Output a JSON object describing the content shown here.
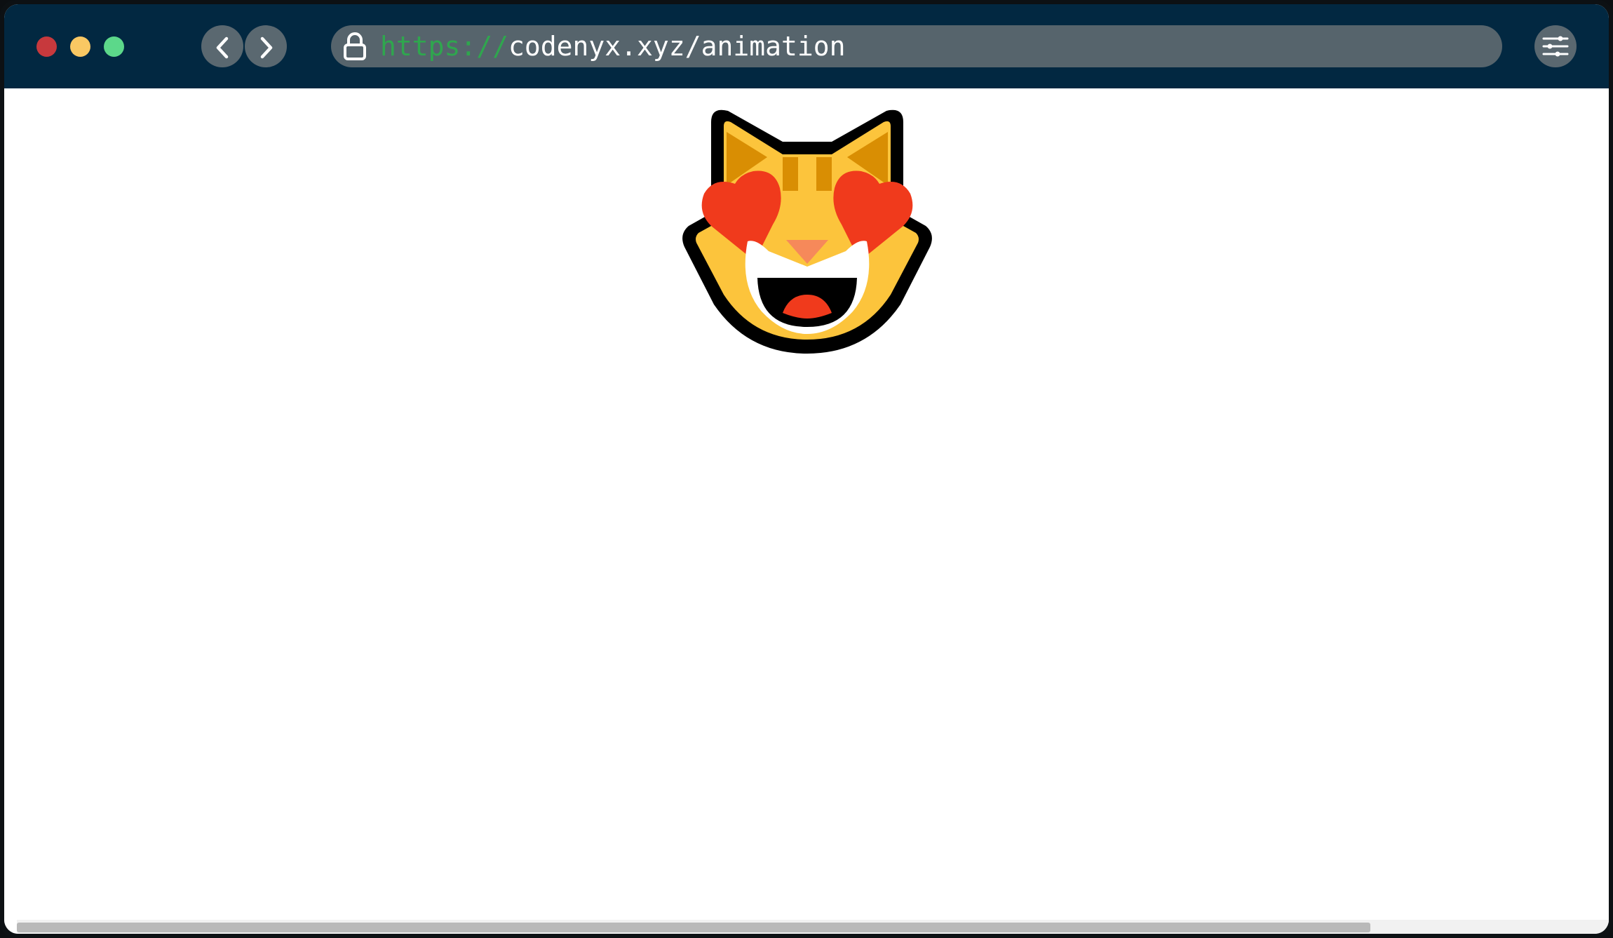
{
  "window": {
    "traffic_lights": [
      {
        "name": "close",
        "color": "#c7393d"
      },
      {
        "name": "minimize",
        "color": "#f9c863"
      },
      {
        "name": "maximize",
        "color": "#5cd88a"
      }
    ]
  },
  "toolbar": {
    "back_icon": "chevron-left-icon",
    "forward_icon": "chevron-right-icon",
    "settings_icon": "sliders-icon",
    "accent_color": "#022841"
  },
  "address_bar": {
    "lock_icon": "lock-icon",
    "scheme": "https://",
    "host_path": "codenyx.xyz/animation",
    "scheme_color": "#2fa64e"
  },
  "content": {
    "emoji_icon": "smiling-cat-with-heart-eyes-icon"
  },
  "scrollbar": {
    "horizontal_position_fraction": 0.0,
    "visible_fraction": 0.85
  }
}
